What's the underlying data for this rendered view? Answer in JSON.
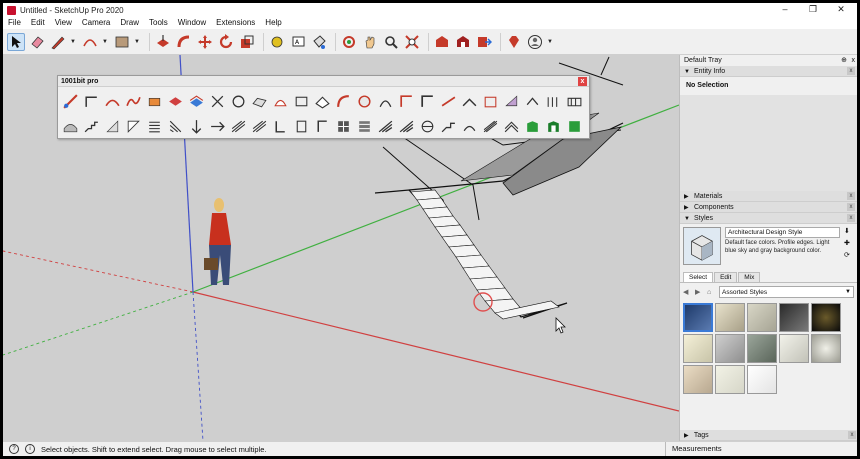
{
  "window": {
    "title": "Untitled - SketchUp Pro 2020",
    "controls": [
      "–",
      "❐",
      "✕"
    ]
  },
  "menu": [
    "File",
    "Edit",
    "View",
    "Camera",
    "Draw",
    "Tools",
    "Window",
    "Extensions",
    "Help"
  ],
  "floating_toolbar": {
    "title": "1001bit pro",
    "close_label": "x"
  },
  "tray": {
    "title": "Default Tray",
    "pin": "⊕",
    "close": "x",
    "panels": {
      "entity_info": {
        "label": "Entity Info",
        "value": "No Selection"
      },
      "materials": {
        "label": "Materials"
      },
      "components": {
        "label": "Components"
      },
      "styles": {
        "label": "Styles",
        "style_name": "Architectural Design Style",
        "description": "Default face colors. Profile edges. Light blue sky and gray background color.",
        "tabs": [
          "Select",
          "Edit",
          "Mix"
        ],
        "collection": "Assorted Styles"
      },
      "tags": {
        "label": "Tags"
      }
    }
  },
  "status": {
    "message": "Select objects. Shift to extend select. Drag mouse to select multiple.",
    "measurements_label": "Measurements"
  },
  "colors": {
    "viewport_bg": "#cfcfcf",
    "axis_red": "#d04040",
    "axis_green": "#40b040",
    "axis_blue": "#4050c8"
  }
}
